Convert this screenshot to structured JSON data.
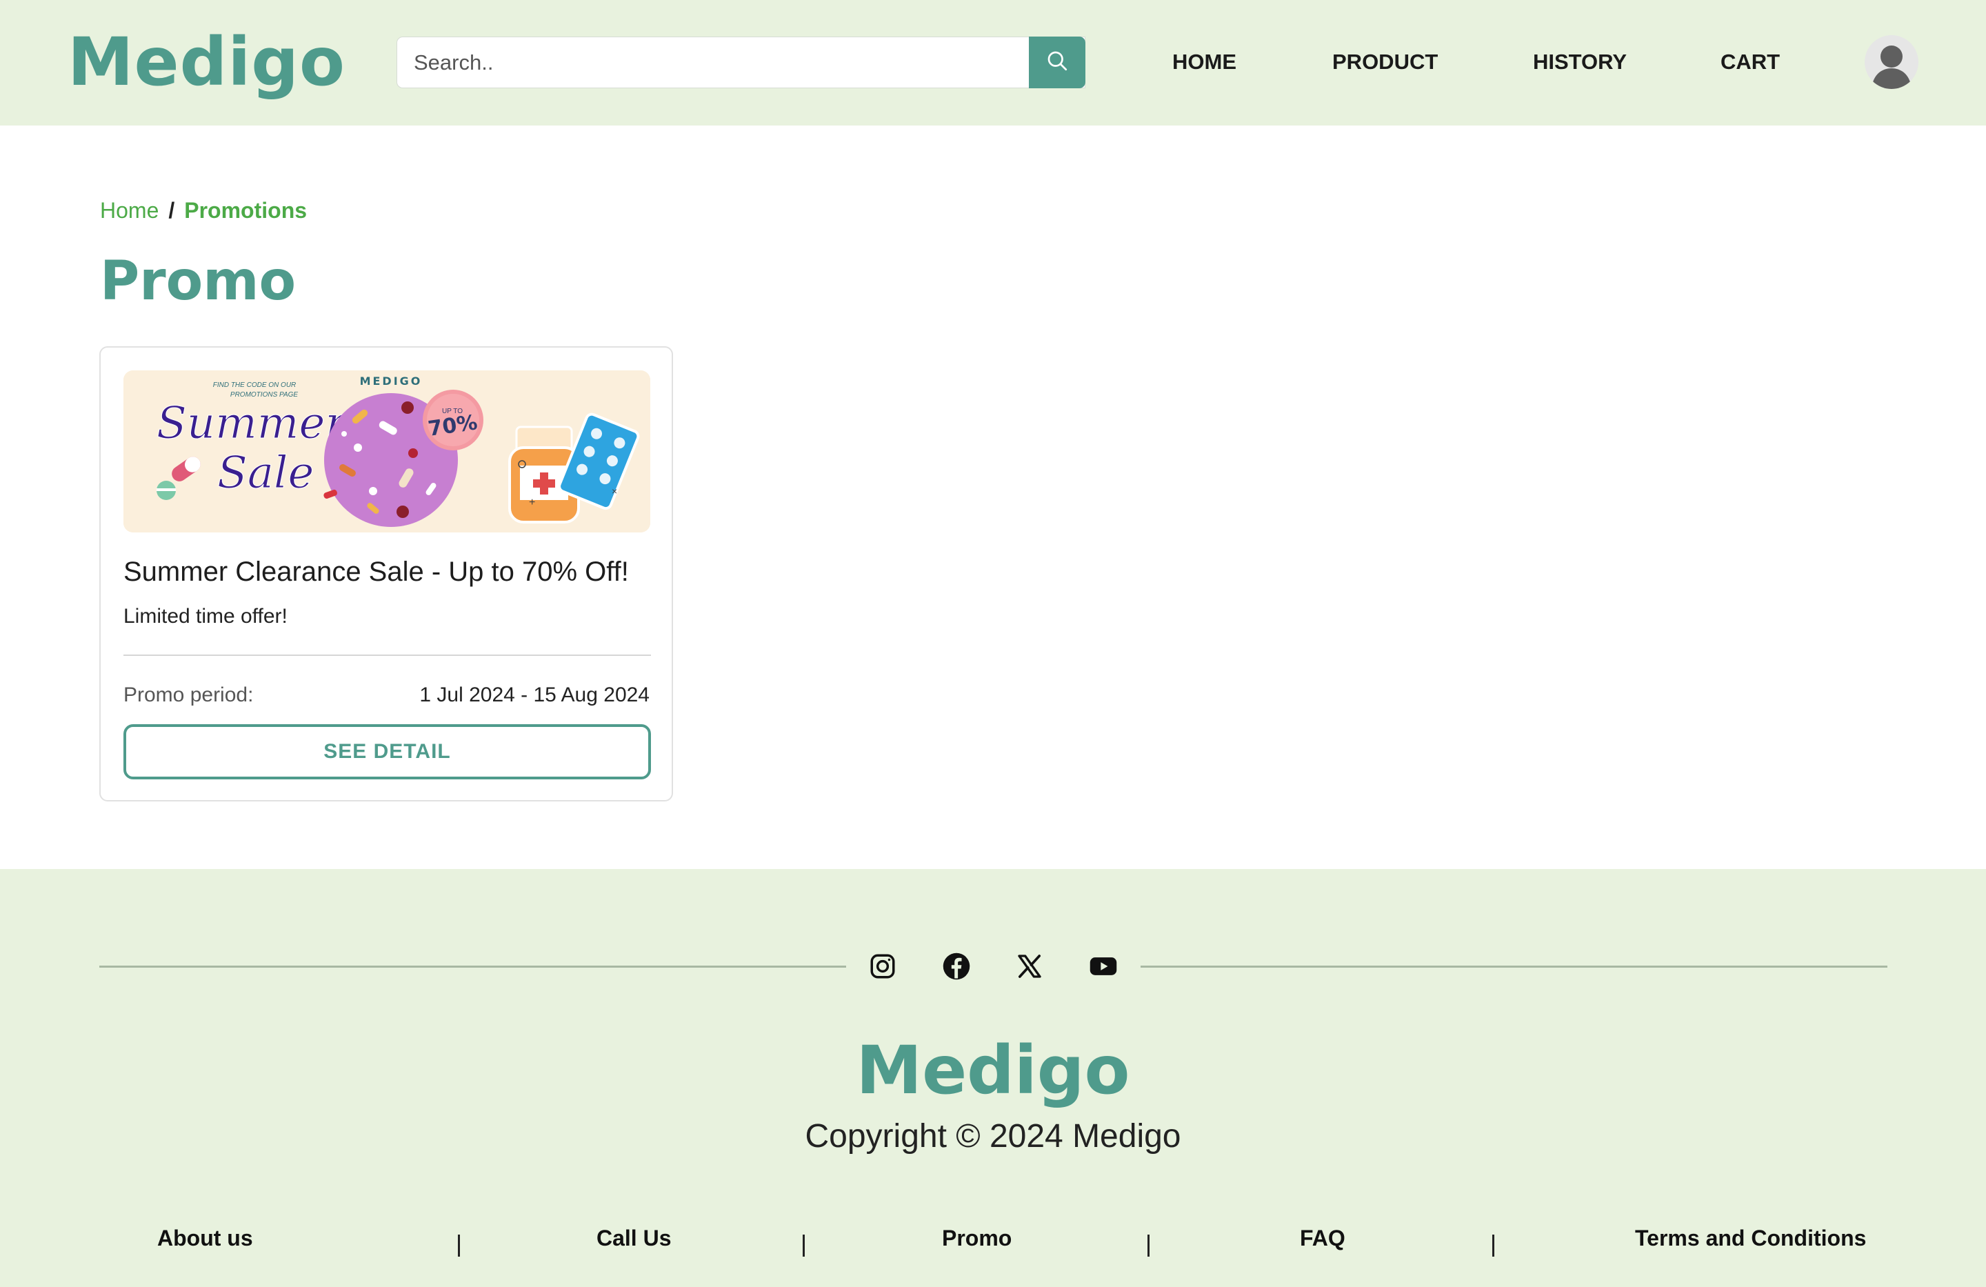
{
  "header": {
    "logo": "Medigo",
    "search_placeholder": "Search..",
    "nav": [
      "HOME",
      "PRODUCT",
      "HISTORY",
      "CART"
    ]
  },
  "breadcrumb": {
    "home": "Home",
    "separator": "/",
    "current": "Promotions"
  },
  "page": {
    "title": "Promo"
  },
  "promo_card": {
    "banner": {
      "brand": "MEDIGO",
      "find_code_line1": "FIND THE CODE ON OUR",
      "find_code_line2": "PROMOTIONS PAGE",
      "script_line1": "Summer",
      "script_line2": "Sale",
      "badge_small": "UP TO",
      "badge_big": "70%"
    },
    "title": "Summer Clearance Sale - Up to 70% Off!",
    "subtitle": "Limited time offer!",
    "period_label": "Promo period:",
    "period_value": "1 Jul 2024 - 15 Aug 2024",
    "button": "SEE DETAIL"
  },
  "footer": {
    "social_icons": [
      "instagram-icon",
      "facebook-icon",
      "x-icon",
      "youtube-icon"
    ],
    "logo": "Medigo",
    "copyright": "Copyright © 2024 Medigo",
    "links": [
      "About us",
      "Call Us",
      "Promo",
      "FAQ",
      "Terms and Conditions"
    ]
  },
  "colors": {
    "brand": "#4f9b8c",
    "header_bg": "#e8f2de",
    "breadcrumb_green": "#4caa47"
  }
}
